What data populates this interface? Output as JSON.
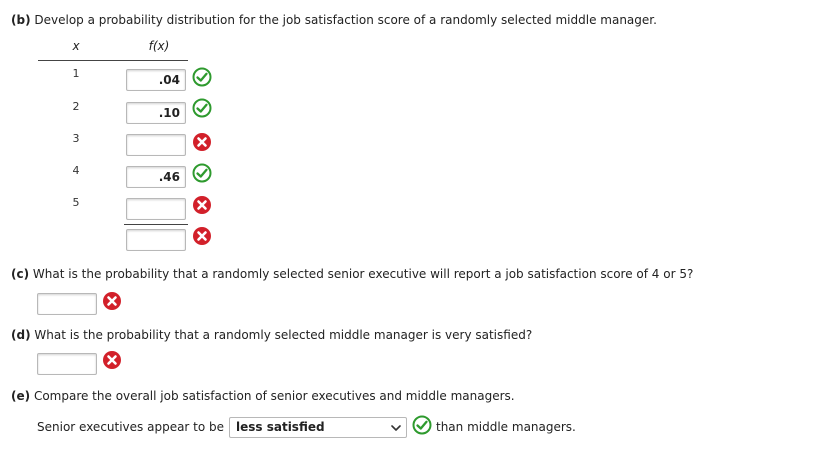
{
  "part_b": {
    "label": "(b)",
    "question": "Develop a probability distribution for the job satisfaction score of a randomly selected middle manager.",
    "col_x": "x",
    "col_fx": "f(x)",
    "rows": [
      {
        "x": "1",
        "value": ".04",
        "status": "correct"
      },
      {
        "x": "2",
        "value": ".10",
        "status": "correct"
      },
      {
        "x": "3",
        "value": "",
        "status": "incorrect"
      },
      {
        "x": "4",
        "value": ".46",
        "status": "correct"
      },
      {
        "x": "5",
        "value": "",
        "status": "incorrect"
      }
    ],
    "total": {
      "value": "",
      "status": "incorrect"
    }
  },
  "part_c": {
    "label": "(c)",
    "question": "What is the probability that a randomly selected senior executive will report a job satisfaction score of 4 or 5?",
    "value": "",
    "status": "incorrect"
  },
  "part_d": {
    "label": "(d)",
    "question": "What is the probability that a randomly selected middle manager is very satisfied?",
    "value": "",
    "status": "incorrect"
  },
  "part_e": {
    "label": "(e)",
    "question": "Compare the overall job satisfaction of senior executives and middle managers.",
    "prefix": "Senior executives appear to be",
    "selected": "less satisfied",
    "suffix": "than middle managers.",
    "status": "correct"
  },
  "colors": {
    "correct": "#2e9a2e",
    "incorrect": "#d2202a"
  },
  "icons": {
    "correct": "check-circle-icon",
    "incorrect": "x-circle-icon",
    "dropdown": "chevron-down-icon"
  }
}
